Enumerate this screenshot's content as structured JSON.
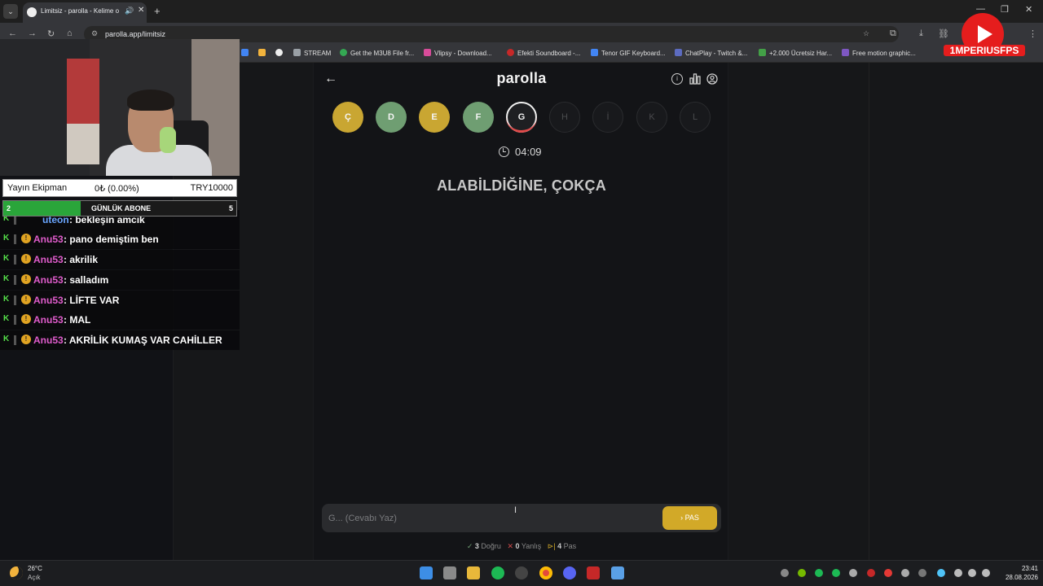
{
  "browser": {
    "tab_title": "Limitsiz - parolla - Kelime o",
    "url": "parolla.app/limitsiz",
    "bookmarks": [
      {
        "label": "STREAM",
        "color": "#9aa0a6"
      },
      {
        "label": "Get the M3U8 File fr...",
        "color": "#34a853"
      },
      {
        "label": "Vlipsy - Download...",
        "color": "#d84c9a"
      },
      {
        "label": "Efekti Soundboard -...",
        "color": "#c62828"
      },
      {
        "label": "Tenor GIF Keyboard...",
        "color": "#4285f4"
      },
      {
        "label": "ChatPlay - Twitch &...",
        "color": "#5c6bc0"
      },
      {
        "label": "+2.000 Ücretsiz Har...",
        "color": "#43a047"
      },
      {
        "label": "Free motion graphic...",
        "color": "#7e57c2"
      }
    ]
  },
  "app": {
    "logo": "parolla",
    "letters": [
      {
        "char": "Ç",
        "state": "yellow"
      },
      {
        "char": "D",
        "state": "green"
      },
      {
        "char": "E",
        "state": "yellow"
      },
      {
        "char": "F",
        "state": "green"
      },
      {
        "char": "G",
        "state": "current"
      },
      {
        "char": "H",
        "state": "empty"
      },
      {
        "char": "İ",
        "state": "empty"
      },
      {
        "char": "K",
        "state": "empty"
      },
      {
        "char": "L",
        "state": "empty"
      }
    ],
    "timer": "04:09",
    "clue": "ALABİLDİĞİNE, ÇOKÇA",
    "answer_placeholder": "G... (Cevabı Yaz)",
    "pas_label": "PAS",
    "stats": {
      "correct_count": "3",
      "correct_label": "Doğru",
      "wrong_count": "0",
      "wrong_label": "Yanlış",
      "pass_count": "4",
      "pass_label": "Pas"
    }
  },
  "stream": {
    "donate": {
      "label": "Yayın Ekipman",
      "progress": "0₺ (0.00%)",
      "goal": "TRY10000"
    },
    "abone": {
      "left": "2",
      "label": "GÜNLÜK ABONE",
      "right": "5"
    },
    "chat": [
      {
        "user": "uteon",
        "msg": ": bekleşin amcık"
      },
      {
        "user": "Anu53",
        "msg": ": pano demiştim ben"
      },
      {
        "user": "Anu53",
        "msg": ": akrilik"
      },
      {
        "user": "Anu53",
        "msg": ": salladım"
      },
      {
        "user": "Anu53",
        "msg": ": LİFTE VAR"
      },
      {
        "user": "Anu53",
        "msg": ": MAL"
      },
      {
        "user": "Anu53",
        "msg": ": AKRİLİK KUMAŞ VAR CAHİLLER"
      }
    ],
    "channel": "1MPERIUSFPS"
  },
  "taskbar": {
    "temp": "26°C",
    "weather": "Açık",
    "time": "23:41",
    "date": "28.08.2026"
  }
}
